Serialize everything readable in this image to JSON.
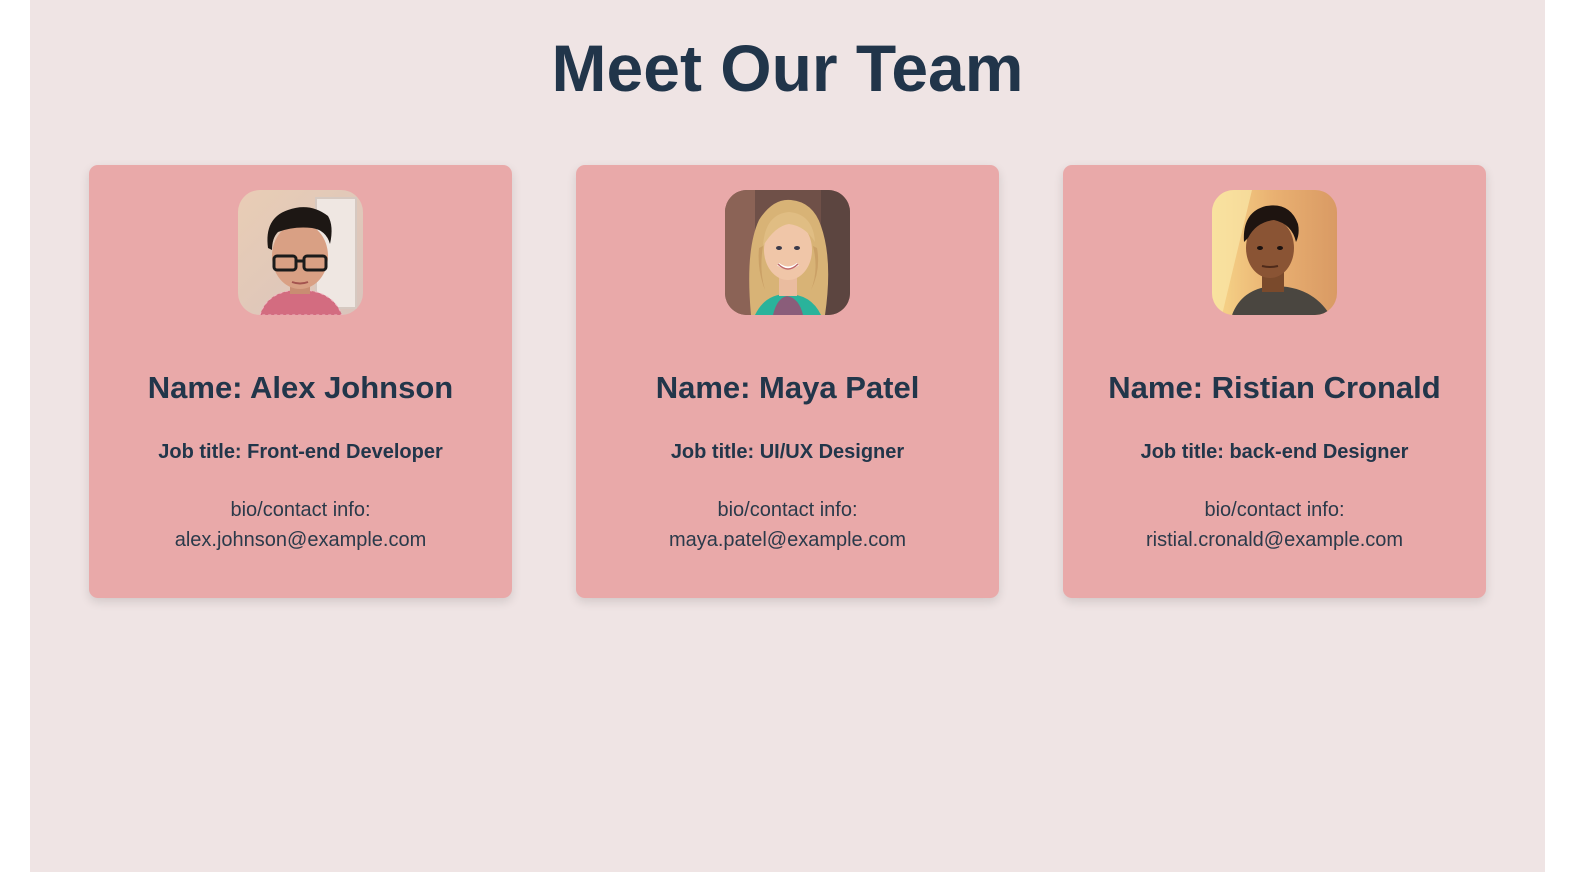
{
  "page": {
    "title": "Meet Our Team",
    "background_color": "#efe4e4",
    "card_color": "#e9a9a9",
    "text_color": "#21354a"
  },
  "team": [
    {
      "name": "Name: Alex Johnson",
      "job": "Job title: Front-end Developer",
      "bio_label": "bio/contact info:",
      "email": "alex.johnson@example.com",
      "photo": "person-with-glasses-avatar"
    },
    {
      "name": "Name: Maya Patel",
      "job": "Job title: UI/UX Designer",
      "bio_label": "bio/contact info:",
      "email": "maya.patel@example.com",
      "photo": "blonde-woman-avatar"
    },
    {
      "name": "Name: Ristian Cronald",
      "job": "Job title: back-end Designer",
      "bio_label": "bio/contact info:",
      "email": "ristial.cronald@example.com",
      "photo": "man-dark-hair-avatar"
    }
  ]
}
